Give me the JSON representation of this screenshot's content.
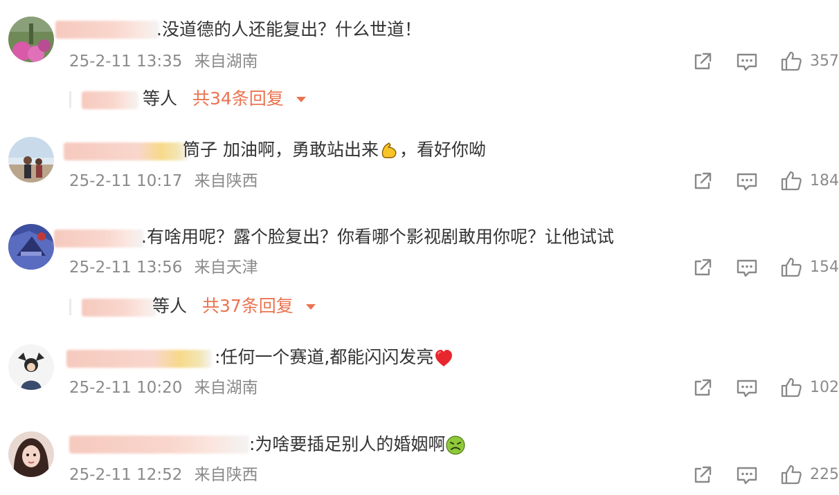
{
  "comments": [
    {
      "text_prefix": "",
      "text": ".没道德的人还能复出？什么世道！",
      "time": "25-2-11 13:35",
      "location": "来自湖南",
      "likes": "357",
      "replies": {
        "who": "等人",
        "total": "共34条回复"
      }
    },
    {
      "text": "筒子 加油啊，勇敢站出来",
      "text_suffix": "，看好你呦",
      "emoji": "flexed-biceps-emoji",
      "time": "25-2-11 10:17",
      "location": "来自陕西",
      "likes": "184"
    },
    {
      "text": ".有啥用呢？露个脸复出？你看哪个影视剧敢用你呢？让他试试",
      "time": "25-2-11 13:56",
      "location": "来自天津",
      "likes": "154",
      "replies": {
        "who": "等人",
        "total": "共37条回复"
      }
    },
    {
      "text": ":任何一个赛道,都能闪闪发亮",
      "emoji": "red-heart-emoji",
      "time": "25-2-11 10:20",
      "location": "来自湖南",
      "likes": "102"
    },
    {
      "text": ":为啥要插足别人的婚姻啊",
      "emoji": "nauseated-face-emoji",
      "time": "25-2-11 12:52",
      "location": "来自陕西",
      "likes": "225"
    }
  ],
  "icons": {
    "share": "share-icon",
    "comment": "comment-icon",
    "like": "thumbs-up-icon"
  },
  "colors": {
    "reply_accent": "#eb7350",
    "meta_text": "#8a8a8a",
    "body_text": "#333333"
  }
}
